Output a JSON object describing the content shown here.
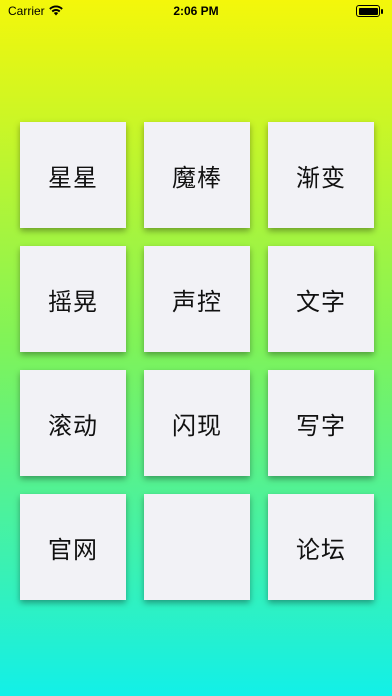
{
  "status_bar": {
    "carrier": "Carrier",
    "time": "2:06 PM"
  },
  "tiles": [
    {
      "label": "星星"
    },
    {
      "label": "魔棒"
    },
    {
      "label": "渐变"
    },
    {
      "label": "摇晃"
    },
    {
      "label": "声控"
    },
    {
      "label": "文字"
    },
    {
      "label": "滚动"
    },
    {
      "label": "闪现"
    },
    {
      "label": "写字"
    },
    {
      "label": "官网"
    },
    {
      "label": ""
    },
    {
      "label": "论坛"
    }
  ]
}
